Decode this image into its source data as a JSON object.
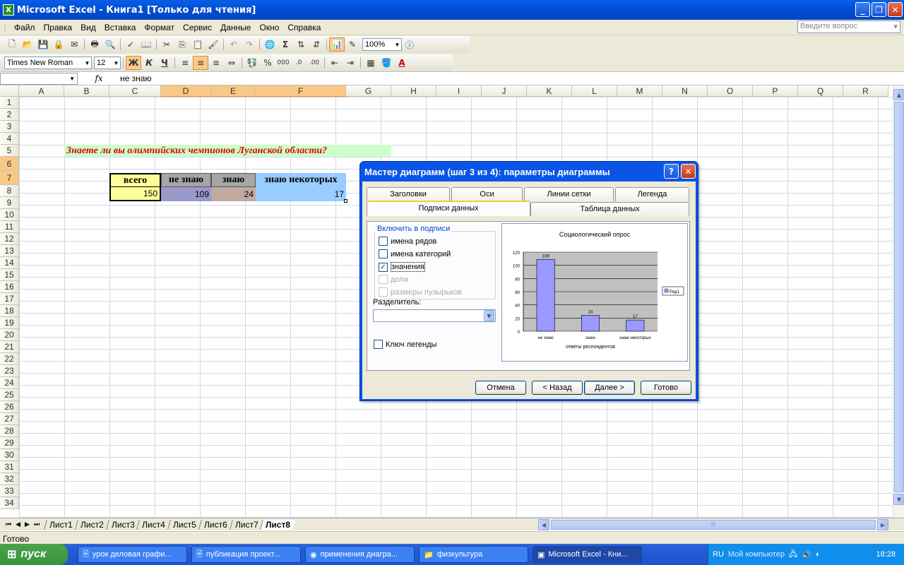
{
  "app": {
    "title": "Microsoft Excel - Книга1  [Только для чтения]"
  },
  "menu": {
    "items": [
      "Файл",
      "Правка",
      "Вид",
      "Вставка",
      "Формат",
      "Сервис",
      "Данные",
      "Окно",
      "Справка"
    ],
    "ask_placeholder": "Введите вопрос"
  },
  "toolbar": {
    "zoom": "100%",
    "font": "Times New Roman",
    "size": "12",
    "bold": "Ж",
    "italic": "К",
    "underline": "Ч",
    "percent": "%",
    "thousands": "000",
    "sigma": "Σ"
  },
  "formula_bar": {
    "fx": "fx",
    "value": "не знаю"
  },
  "columns": [
    "A",
    "B",
    "C",
    "D",
    "E",
    "F",
    "G",
    "H",
    "I",
    "J",
    "K",
    "L",
    "M",
    "N",
    "O",
    "P",
    "Q",
    "R"
  ],
  "rows": [
    "1",
    "2",
    "3",
    "4",
    "5",
    "6",
    "7",
    "8",
    "9",
    "10",
    "11",
    "12",
    "13",
    "14",
    "15",
    "16",
    "17",
    "18",
    "19",
    "20",
    "21",
    "22",
    "23",
    "24",
    "25",
    "26",
    "27",
    "28",
    "29",
    "30",
    "31",
    "32",
    "33",
    "34"
  ],
  "sheet": {
    "question": "Знаете ли вы олимпийских чемпионов Луганской области?",
    "headers": [
      "всего",
      "не знаю",
      "знаю",
      "знаю некоторых"
    ],
    "values": [
      "150",
      "109",
      "24",
      "17"
    ]
  },
  "colors": {
    "question_fill": "#ccffcc",
    "question_text": "#e00000",
    "total_fill": "#ffff99",
    "header_fill": "#a6a6a6",
    "d_fill": "#9999cc",
    "e_fill": "#c0a99f",
    "f_fill": "#99ccff"
  },
  "dialog": {
    "title": "Мастер диаграмм (шаг 3 из 4): параметры диаграммы",
    "tabs_top": [
      "Заголовки",
      "Оси",
      "Линии сетки",
      "Легенда"
    ],
    "tabs_bottom": [
      "Подписи данных",
      "Таблица данных"
    ],
    "group_label": "Включить в подписи",
    "checks": [
      {
        "label": "имена рядов",
        "checked": false,
        "enabled": true
      },
      {
        "label": "имена категорий",
        "checked": false,
        "enabled": true
      },
      {
        "label": "значения",
        "checked": true,
        "enabled": true
      },
      {
        "label": "доли",
        "checked": false,
        "enabled": false
      },
      {
        "label": "размеры пузырьков",
        "checked": false,
        "enabled": false
      }
    ],
    "separator_label": "Разделитель:",
    "legend_key_label": "Ключ легенды",
    "buttons": {
      "cancel": "Отмена",
      "back": "< Назад",
      "next": "Далее >",
      "finish": "Готово"
    }
  },
  "chart_data": {
    "type": "bar",
    "title": "Социологический опрос",
    "categories": [
      "не знаю",
      "знаю",
      "знаю некоторых"
    ],
    "series": [
      {
        "name": "Ряд1",
        "values": [
          109,
          24,
          17
        ]
      }
    ],
    "xlabel": "ответы респондентов",
    "ylabel": "",
    "ylim": [
      0,
      120
    ],
    "yticks": [
      "0",
      "20",
      "40",
      "60",
      "80",
      "100",
      "120"
    ],
    "data_labels": [
      "109",
      "24",
      "17"
    ],
    "bar_color": "#9999ff",
    "plot_bg": "#c0c0c0",
    "legend": "right",
    "grid": true
  },
  "sheet_tabs": [
    "Лист1",
    "Лист2",
    "Лист3",
    "Лист4",
    "Лист5",
    "Лист6",
    "Лист7",
    "Лист8"
  ],
  "active_sheet": "Лист8",
  "status": "Готово",
  "taskbar": {
    "start": "пуск",
    "tasks": [
      "урок деловая графи...",
      "публикация проект...",
      "применения диагра...",
      "физкультура",
      "Microsoft Excel - Кни..."
    ],
    "lang": "RU",
    "my_computer": "Мой компьютер",
    "time": "18:28"
  }
}
